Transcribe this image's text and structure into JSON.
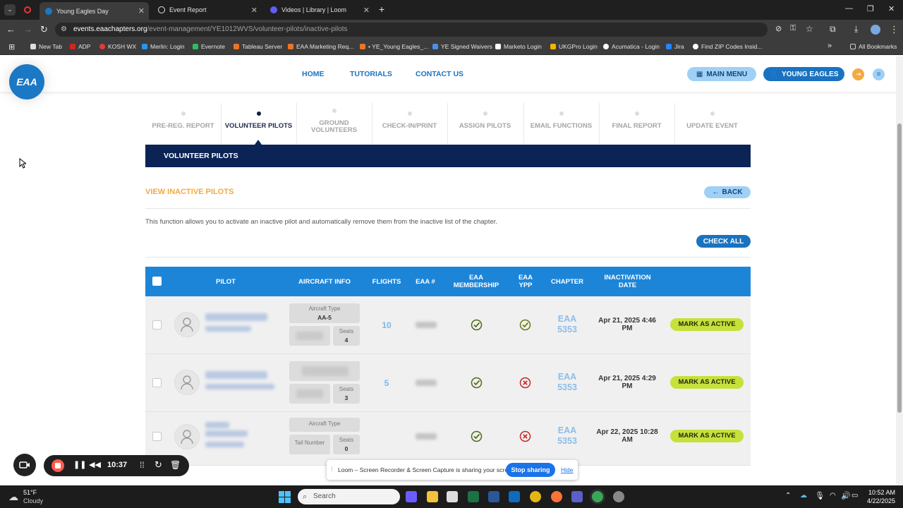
{
  "tabs": [
    {
      "label": "Young Eagles Day",
      "active": true,
      "icon_color": "#1b78c4"
    },
    {
      "label": "Event Report",
      "active": false,
      "icon_color": "#e3e3e3"
    },
    {
      "label": "Videos | Library | Loom",
      "active": false,
      "icon_color": "#625df5"
    }
  ],
  "address": {
    "host": "events.eaachapters.org",
    "path": "/event-management/YE1012WVS/volunteer-pilots/inactive-pilots"
  },
  "bookmarks": [
    {
      "label": "New Tab",
      "color": "#dddddd"
    },
    {
      "label": "ADP",
      "color": "#d0271d"
    },
    {
      "label": "KOSH WX",
      "color": "#e53935"
    },
    {
      "label": "Merlin: Login",
      "color": "#2196f3"
    },
    {
      "label": "Evernote",
      "color": "#2dbe60"
    },
    {
      "label": "Tableau Server",
      "color": "#e97627"
    },
    {
      "label": "EAA Marketing Req...",
      "color": "#e97627"
    },
    {
      "label": "• YE_Young Eagles_...",
      "color": "#e97627"
    },
    {
      "label": "YE Signed Waivers",
      "color": "#4a8fe7"
    },
    {
      "label": "Marketo Login",
      "color": "#ffffff"
    },
    {
      "label": "UKGPro Login",
      "color": "#f5b400"
    },
    {
      "label": "Acumatica - Login",
      "color": "#ffffff"
    },
    {
      "label": "Jira",
      "color": "#2684ff"
    },
    {
      "label": "Find ZIP Codes Insid...",
      "color": "#ffffff"
    }
  ],
  "all_bookmarks": "All Bookmarks",
  "header": {
    "logo_text": "EAA",
    "nav": [
      "HOME",
      "TUTORIALS",
      "CONTACT US"
    ],
    "main_menu": "MAIN MENU",
    "young_eagles": "YOUNG EAGLES"
  },
  "steps": [
    {
      "label": "PRE-REG. REPORT",
      "active": false
    },
    {
      "label": "VOLUNTEER PILOTS",
      "active": true
    },
    {
      "label": "GROUND VOLUNTEERS",
      "active": false
    },
    {
      "label": "CHECK-IN/PRINT",
      "active": false
    },
    {
      "label": "ASSIGN PILOTS",
      "active": false
    },
    {
      "label": "EMAIL FUNCTIONS",
      "active": false
    },
    {
      "label": "FINAL REPORT",
      "active": false
    },
    {
      "label": "UPDATE EVENT",
      "active": false
    }
  ],
  "section_title": "VOLUNTEER PILOTS",
  "view_title": "VIEW INACTIVE PILOTS",
  "back_label": "BACK",
  "description": "This function allows you to activate an inactive pilot and automatically remove them from the inactive list of the chapter.",
  "check_all": "CHECK ALL",
  "table": {
    "headers": [
      "PILOT",
      "AIRCRAFT INFO",
      "FLIGHTS",
      "EAA #",
      "EAA MEMBERSHIP",
      "EAA YPP",
      "CHAPTER",
      "INACTIVATION DATE"
    ],
    "rows": [
      {
        "aircraft_type_label": "Aircraft Type",
        "aircraft_type": "AA-5",
        "tail_label": "",
        "seats_label": "Seats",
        "seats": "4",
        "flights": "10",
        "membership": "check",
        "ypp": "check",
        "chapter_line1": "EAA",
        "chapter_line2": "5353",
        "date": "Apr 21, 2025 4:46 PM",
        "action": "MARK AS ACTIVE"
      },
      {
        "aircraft_type_label": "",
        "aircraft_type": "",
        "tail_label": "",
        "seats_label": "Seats",
        "seats": "3",
        "flights": "5",
        "membership": "check",
        "ypp": "x",
        "chapter_line1": "EAA",
        "chapter_line2": "5353",
        "date": "Apr 21, 2025 4:29 PM",
        "action": "MARK AS ACTIVE"
      },
      {
        "aircraft_type_label": "Aircraft Type",
        "aircraft_type": "",
        "tail_label": "Tail Number",
        "seats_label": "Seats",
        "seats": "0",
        "flights": "",
        "membership": "check",
        "ypp": "x",
        "chapter_line1": "EAA",
        "chapter_line2": "5353",
        "date": "Apr 22, 2025 10:28 AM",
        "action": "MARK AS ACTIVE"
      }
    ]
  },
  "loom": {
    "time": "10:37",
    "share_message": "Loom – Screen Recorder & Screen Capture is sharing your screen.",
    "stop": "Stop sharing",
    "hide": "Hide"
  },
  "taskbar": {
    "weather_temp": "51°F",
    "weather_desc": "Cloudy",
    "search": "Search",
    "time": "10:52 AM",
    "date": "4/22/2025"
  }
}
